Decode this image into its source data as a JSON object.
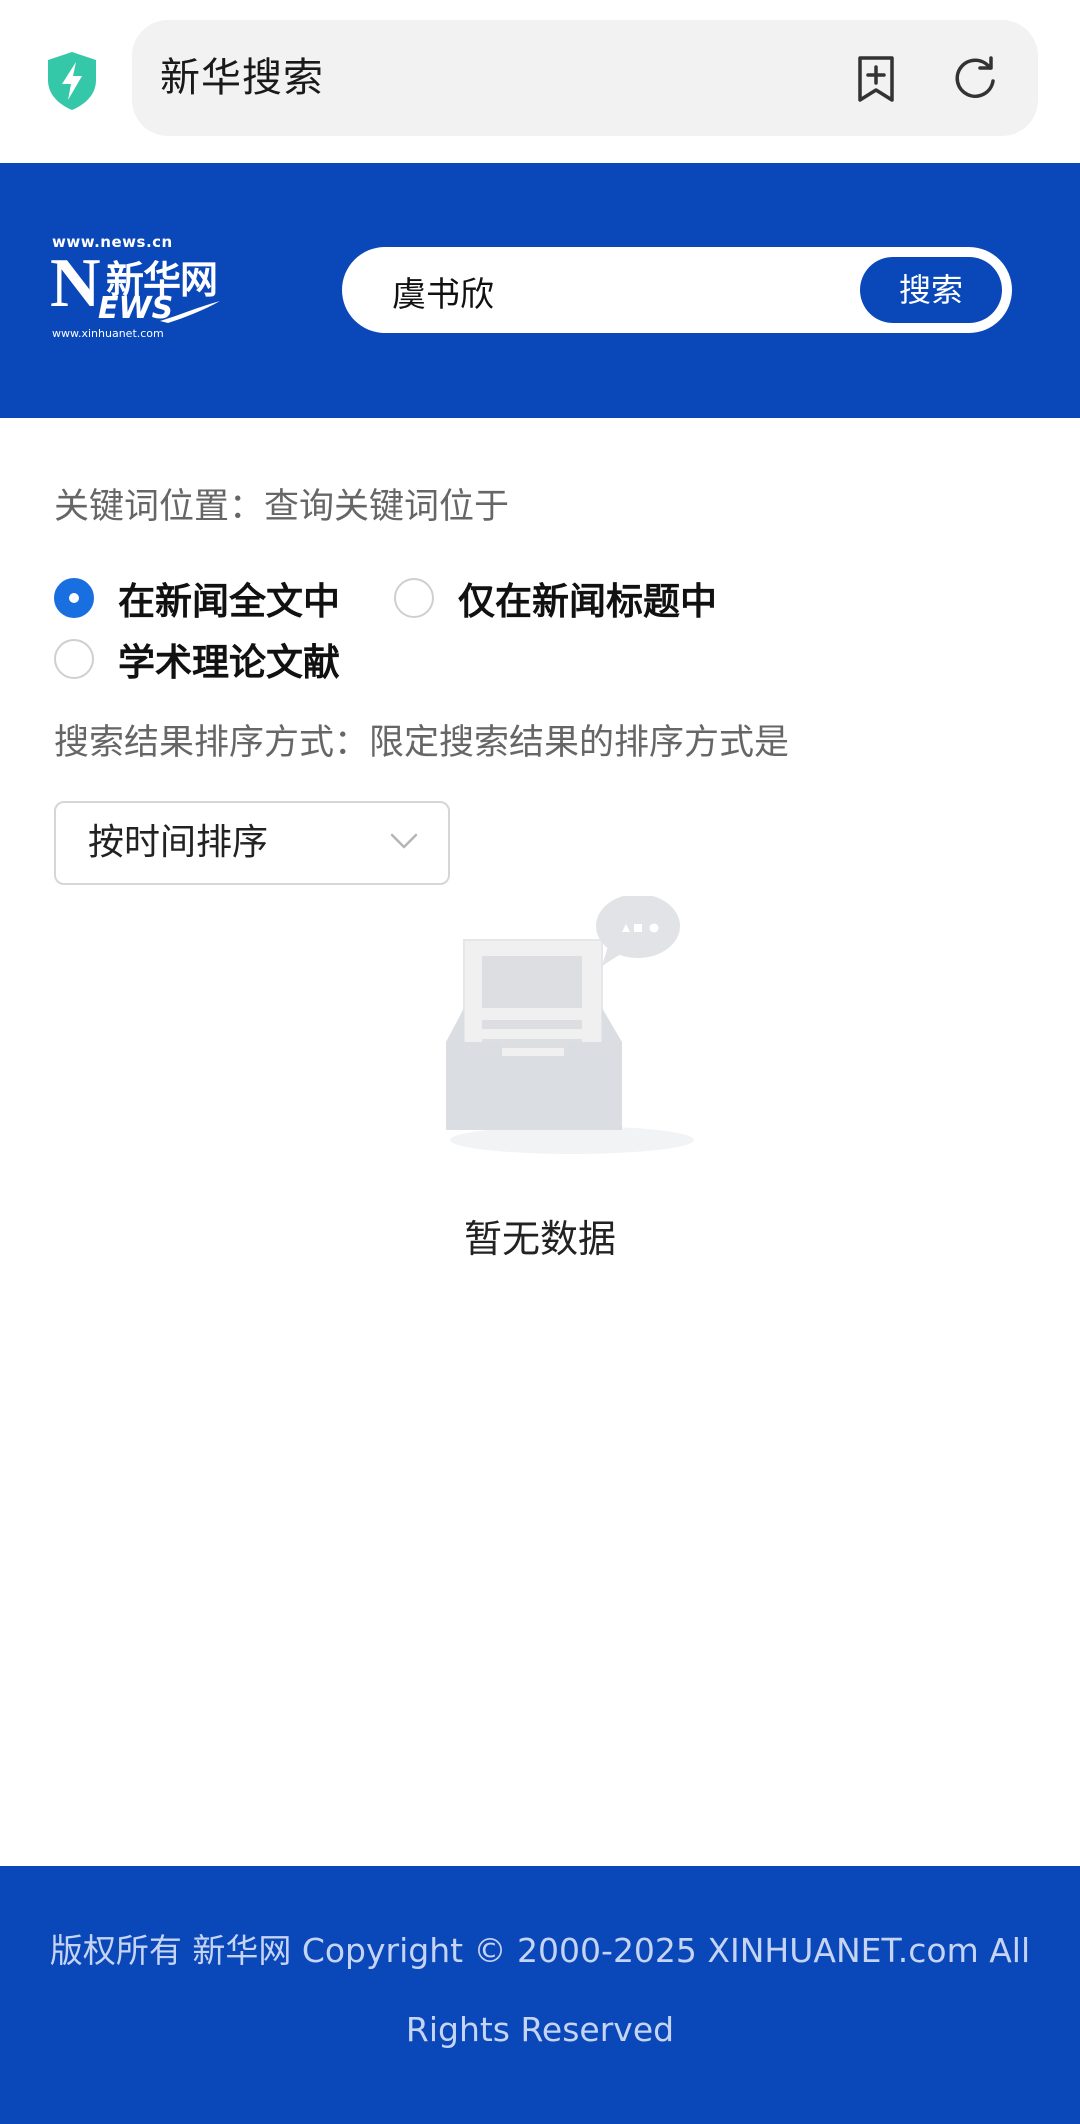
{
  "browser": {
    "title": "新华搜索"
  },
  "header": {
    "logo": {
      "domain_top": "www.news.cn",
      "letter": "N",
      "cn_name": "新华网",
      "ews": "EWS",
      "domain_bottom": "www.xinhuanet.com"
    },
    "search": {
      "value": "虞书欣",
      "button_label": "搜索"
    }
  },
  "filters": {
    "keyword_position_label": "关键词位置：查询关键词位于",
    "options": [
      {
        "label": "在新闻全文中",
        "checked": true
      },
      {
        "label": "仅在新闻标题中",
        "checked": false
      },
      {
        "label": "学术理论文献",
        "checked": false
      }
    ],
    "sort_label": "搜索结果排序方式：限定搜索结果的排序方式是",
    "sort_selected": "按时间排序"
  },
  "results": {
    "empty_text": "暂无数据"
  },
  "footer": {
    "line1": "版权所有 新华网 Copyright © 2000-2025 XINHUANET.com All",
    "line2": "Rights Reserved"
  },
  "colors": {
    "brand_blue": "#0a47b8",
    "radio_active": "#1a6fe0",
    "shield_green": "#35c8a8"
  }
}
